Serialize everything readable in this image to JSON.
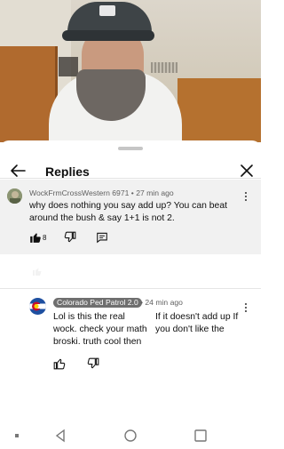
{
  "sheet": {
    "title": "Replies",
    "back_icon": "arrow-left-icon",
    "close_icon": "close-icon"
  },
  "parent_comment": {
    "author": "WockFrmCrossWestern 6971",
    "time": "27 min ago",
    "text": "why does nothing you say add up? You can beat around the bush & say 1+1 is not 2.",
    "likes": "8",
    "icons": [
      "thumbs-up-icon",
      "thumbs-down-icon",
      "reply-icon"
    ]
  },
  "reply": {
    "author": "Colorado Ped Patrol 2.0",
    "time": "24 min ago",
    "text_left": "Lol is this the real wock. check your math broski. truth cool then",
    "text_right": "If it doesn't add up If you don't like the",
    "icons": [
      "thumbs-up-icon",
      "thumbs-down-icon"
    ],
    "accent": "#6f6f6f"
  },
  "colors": {
    "flag_red": "#c8102e",
    "flag_blue": "#1e4fa0",
    "flag_yellow": "#ffd200"
  },
  "navbar": [
    "menu-dot-icon",
    "back-triangle-icon",
    "home-circle-icon",
    "recents-square-icon"
  ]
}
